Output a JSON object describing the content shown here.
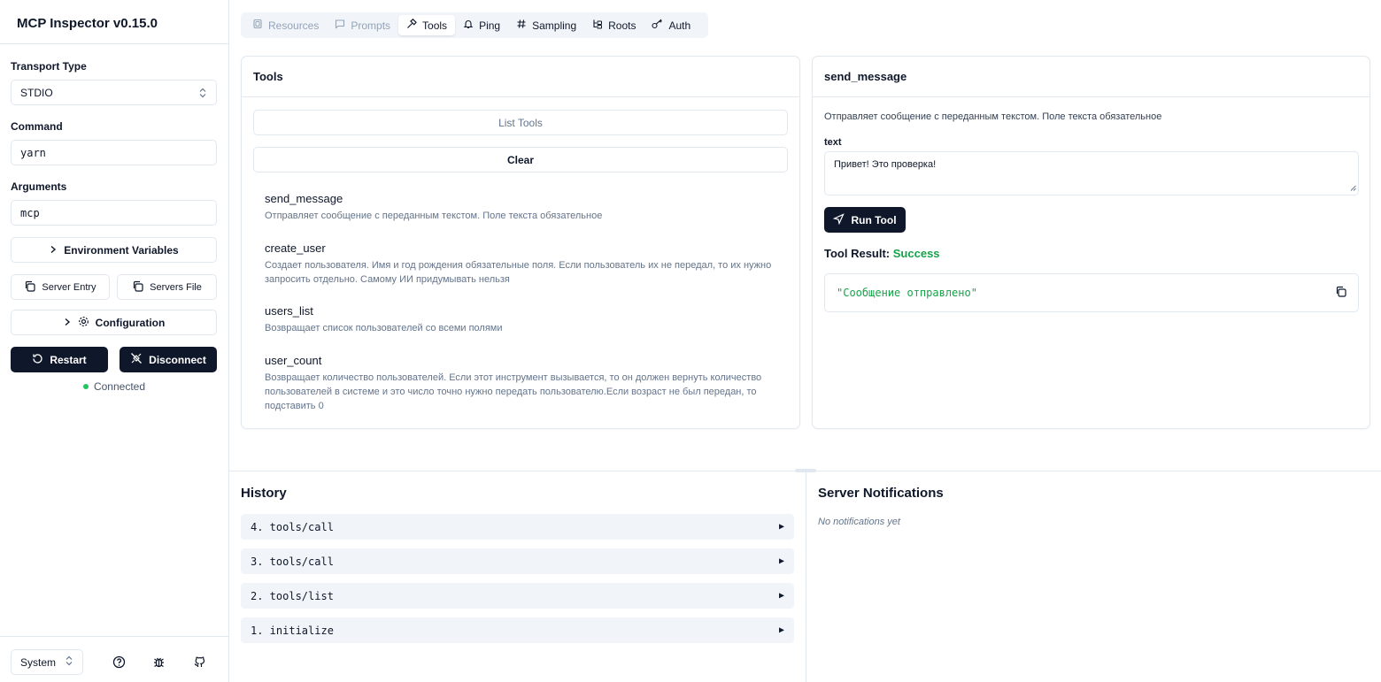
{
  "app": {
    "title": "MCP Inspector v0.15.0"
  },
  "sidebar": {
    "transport_label": "Transport Type",
    "transport_value": "STDIO",
    "command_label": "Command",
    "command_value": "yarn",
    "arguments_label": "Arguments",
    "arguments_value": "mcp",
    "env_button": "Environment Variables",
    "server_entry_button": "Server Entry",
    "servers_file_button": "Servers File",
    "config_button": "Configuration",
    "restart_button": "Restart",
    "disconnect_button": "Disconnect",
    "status": "Connected",
    "theme_value": "System"
  },
  "tabs": [
    {
      "label": "Resources",
      "icon": "file-icon",
      "state": "disabled"
    },
    {
      "label": "Prompts",
      "icon": "message-icon",
      "state": "disabled"
    },
    {
      "label": "Tools",
      "icon": "hammer-icon",
      "state": "active"
    },
    {
      "label": "Ping",
      "icon": "bell-icon",
      "state": "normal"
    },
    {
      "label": "Sampling",
      "icon": "hash-icon",
      "state": "normal"
    },
    {
      "label": "Roots",
      "icon": "folder-tree-icon",
      "state": "normal"
    },
    {
      "label": "Auth",
      "icon": "key-icon",
      "state": "normal"
    }
  ],
  "tools_panel": {
    "title": "Tools",
    "list_button": "List Tools",
    "clear_button": "Clear",
    "items": [
      {
        "name": "send_message",
        "description": "Отправляет сообщение с переданным текстом. Поле текста обязательное"
      },
      {
        "name": "create_user",
        "description": "Создает пользователя. Имя и год рождения обязательные поля. Если пользователь их не передал, то их нужно запросить отдельно. Самому ИИ придумывать нельзя"
      },
      {
        "name": "users_list",
        "description": "Возвращает список пользователей со всеми полями"
      },
      {
        "name": "user_count",
        "description": "Возвращает количество пользователей. Если этот инструмент вызывается, то он должен вернуть количество пользователей в системе и это число точно нужно передать пользователю.Если возраст не был передан, то подставить 0"
      }
    ]
  },
  "detail_panel": {
    "title": "send_message",
    "description": "Отправляет сообщение с переданным текстом. Поле текста обязательное",
    "field_label": "text",
    "field_value": "Привет! Это проверка!",
    "run_button": "Run Tool",
    "result_label": "Tool Result:",
    "result_status": "Success",
    "result_value": "\"Сообщение отправлено\""
  },
  "history": {
    "title": "History",
    "items": [
      "4. tools/call",
      "3. tools/call",
      "2. tools/list",
      "1. initialize"
    ]
  },
  "notifications": {
    "title": "Server Notifications",
    "empty": "No notifications yet"
  },
  "colors": {
    "accent": "#0f172a",
    "success": "#16a34a",
    "status_dot": "#22c55e"
  }
}
